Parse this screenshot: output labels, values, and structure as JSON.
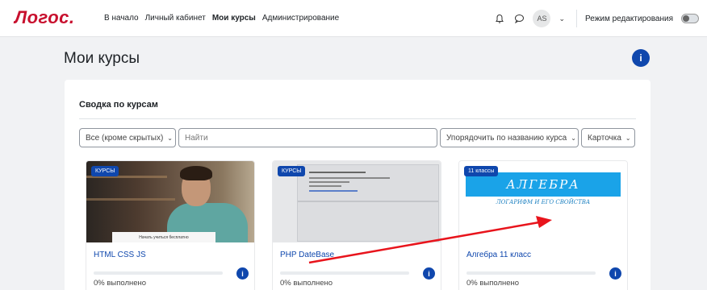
{
  "navbar": {
    "logo": "Логос.",
    "links": [
      "В начало",
      "Личный кабинет",
      "Мои курсы",
      "Администрирование"
    ],
    "active_link": "Мои курсы",
    "avatar_initials": "AS",
    "edit_mode_label": "Режим редактирования",
    "edit_mode_on": false
  },
  "page": {
    "title": "Мои курсы",
    "info_icon": "info-icon"
  },
  "overview": {
    "title": "Сводка по курсам",
    "filter_label": "Все (кроме скрытых)",
    "search_placeholder": "Найти",
    "sort_label": "Упорядочить по названию курса",
    "view_label": "Карточка"
  },
  "courses": [
    {
      "badge": "КУРСЫ",
      "name": "HTML CSS JS",
      "progress_text": "0% выполнено",
      "progress": 0,
      "thumb_caption": "Начать учиться бесплатно"
    },
    {
      "badge": "КУРСЫ",
      "name": "PHP DateBase",
      "progress_text": "0% выполнено",
      "progress": 0
    },
    {
      "badge": "11 классы",
      "name": "Алгебра 11 класс",
      "progress_text": "0% выполнено",
      "progress": 0,
      "banner_title": "АЛГЕБРА",
      "banner_subtitle": "ЛОГАРИФМ И ЕГО СВОЙСТВА"
    }
  ],
  "colors": {
    "brand_red": "#c8102e",
    "primary_blue": "#0f47ad",
    "annotation_arrow": "#e8141c"
  }
}
